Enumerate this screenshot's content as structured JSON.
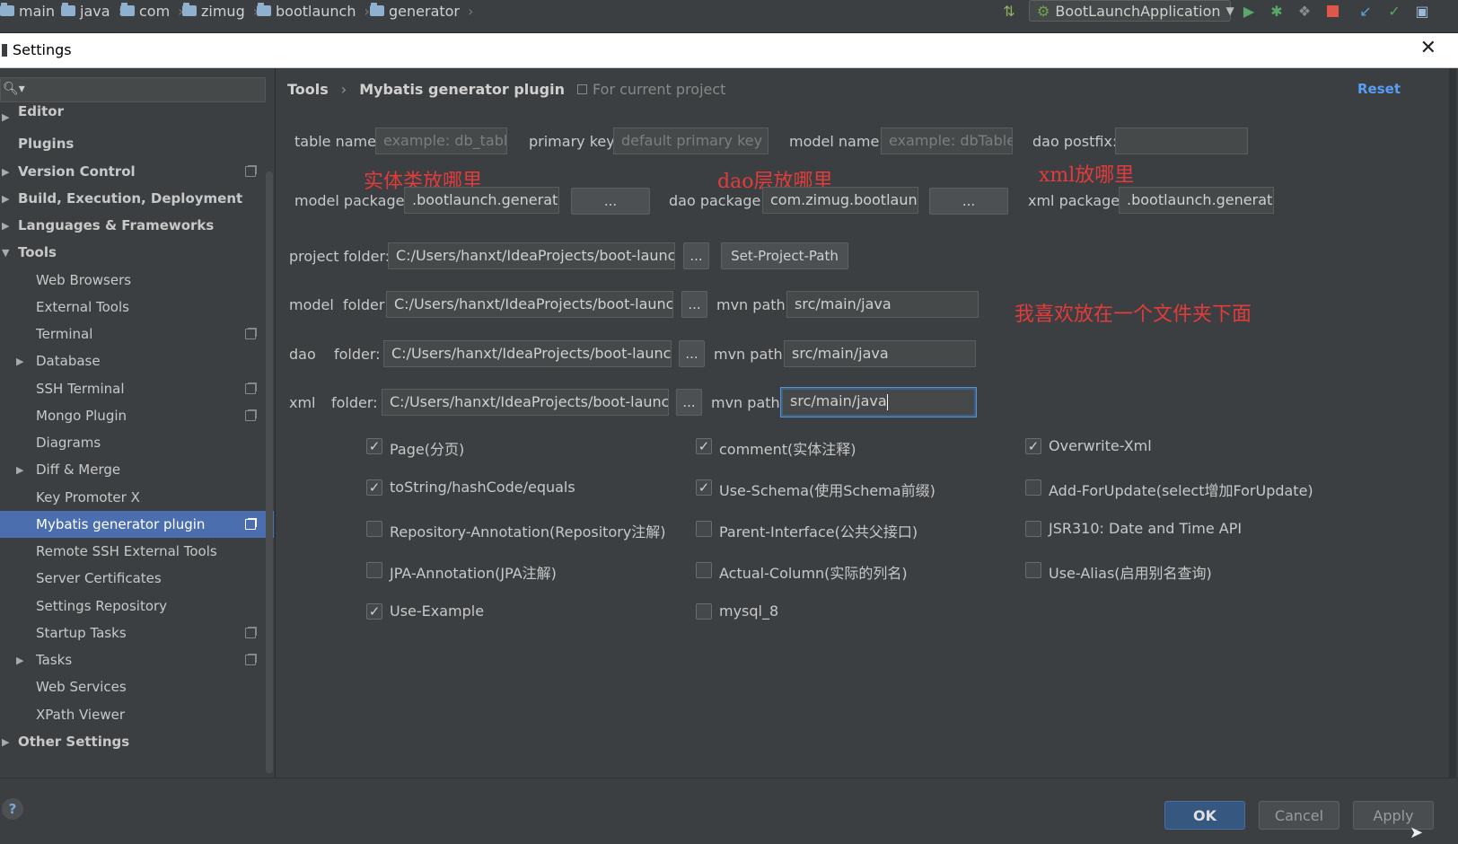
{
  "topbar": {
    "breadcrumbs": [
      "main",
      "java",
      "com",
      "zimug",
      "bootlaunch",
      "generator"
    ],
    "run_config": "BootLaunchApplication"
  },
  "dialog": {
    "title": "Settings"
  },
  "sidebar": {
    "items": [
      {
        "label": "Editor"
      },
      {
        "label": "Plugins"
      },
      {
        "label": "Version Control"
      },
      {
        "label": "Build, Execution, Deployment"
      },
      {
        "label": "Languages & Frameworks"
      },
      {
        "label": "Tools"
      },
      {
        "label": "Web Browsers"
      },
      {
        "label": "External Tools"
      },
      {
        "label": "Terminal"
      },
      {
        "label": "Database"
      },
      {
        "label": "SSH Terminal"
      },
      {
        "label": "Mongo Plugin"
      },
      {
        "label": "Diagrams"
      },
      {
        "label": "Diff & Merge"
      },
      {
        "label": "Key Promoter X"
      },
      {
        "label": "Mybatis generator plugin"
      },
      {
        "label": "Remote SSH External Tools"
      },
      {
        "label": "Server Certificates"
      },
      {
        "label": "Settings Repository"
      },
      {
        "label": "Startup Tasks"
      },
      {
        "label": "Tasks"
      },
      {
        "label": "Web Services"
      },
      {
        "label": "XPath Viewer"
      },
      {
        "label": "Other Settings"
      }
    ]
  },
  "main": {
    "breadcrumb": {
      "parent": "Tools",
      "current": "Mybatis generator plugin",
      "scope": "For current project"
    },
    "reset": "Reset",
    "row1": {
      "table_name_label": "table name:",
      "table_name_placeholder": "example: db_table",
      "primary_key_label": "primary key:",
      "primary_key_placeholder": "default primary key",
      "model_name_label": "model name:",
      "model_name_placeholder": "example: dbTable",
      "dao_postfix_label": "dao postfix:",
      "dao_postfix_value": ""
    },
    "annotations": {
      "model": "实体类放哪里",
      "dao": "dao层放哪里",
      "xml": "xml放哪里",
      "folder": "我喜欢放在一个文件夹下面"
    },
    "row2": {
      "model_package_label": "model package:",
      "model_package_value": ".bootlaunch.generator",
      "dao_package_label": "dao package:",
      "dao_package_value": "com.zimug.bootlaunch",
      "xml_package_label": "xml package:",
      "xml_package_value": ".bootlaunch.generator",
      "browse": "..."
    },
    "project": {
      "label": "project folder:",
      "value": "C:/Users/hanxt/IdeaProjects/boot-launch",
      "browse": "...",
      "set_button": "Set-Project-Path"
    },
    "model_folder": {
      "label": "model  folder:",
      "value": "C:/Users/hanxt/IdeaProjects/boot-launch",
      "browse": "...",
      "mvn_label": "mvn path:",
      "mvn_value": "src/main/java"
    },
    "dao_folder": {
      "label1": "dao",
      "label2": "folder:",
      "value": "C:/Users/hanxt/IdeaProjects/boot-launch",
      "browse": "...",
      "mvn_label": "mvn path:",
      "mvn_value": "src/main/java"
    },
    "xml_folder": {
      "label1": "xml",
      "label2": "folder:",
      "value": "C:/Users/hanxt/IdeaProjects/boot-launch",
      "browse": "...",
      "mvn_label": "mvn path:",
      "mvn_value": "src/main/java"
    },
    "options": [
      {
        "label": "Page(分页)",
        "checked": true
      },
      {
        "label": "comment(实体注释)",
        "checked": true
      },
      {
        "label": "Overwrite-Xml",
        "checked": true
      },
      {
        "label": "toString/hashCode/equals",
        "checked": true
      },
      {
        "label": "Use-Schema(使用Schema前缀)",
        "checked": true
      },
      {
        "label": "Add-ForUpdate(select增加ForUpdate)",
        "checked": false
      },
      {
        "label": "Repository-Annotation(Repository注解)",
        "checked": false
      },
      {
        "label": "Parent-Interface(公共父接口)",
        "checked": false
      },
      {
        "label": "JSR310: Date and Time API",
        "checked": false
      },
      {
        "label": "JPA-Annotation(JPA注解)",
        "checked": false
      },
      {
        "label": "Actual-Column(实际的列名)",
        "checked": false
      },
      {
        "label": "Use-Alias(启用别名查询)",
        "checked": false
      },
      {
        "label": "Use-Example",
        "checked": true
      },
      {
        "label": "mysql_8",
        "checked": false
      }
    ]
  },
  "footer": {
    "help": "?",
    "ok": "OK",
    "cancel": "Cancel",
    "apply": "Apply"
  },
  "colors": {
    "accent": "#4b6eaf",
    "link": "#589df6",
    "annotation": "#e23b3b",
    "background": "#3c3f41"
  }
}
